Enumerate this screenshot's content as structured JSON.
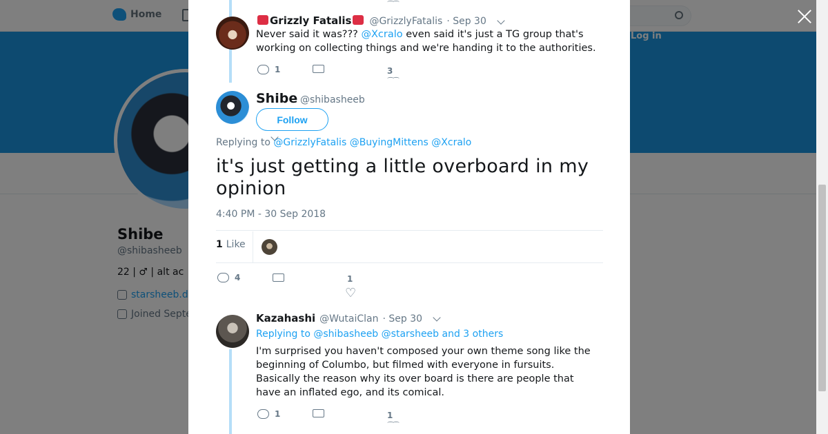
{
  "background_page": {
    "nav": {
      "home_label": "Home",
      "login_label": "Log in"
    },
    "profile": {
      "name": "Shibe",
      "handle": "@shibasheeb",
      "bio_fragment": "22 | ♂ | alt ac",
      "link_fragment": "starsheeb.d",
      "joined_fragment": "Joined Septe"
    }
  },
  "modal": {
    "parent_tweet": {
      "name": "Grizzly Fatalis",
      "handle": "@GrizzlyFatalis",
      "date": "· Sep 30",
      "text_before": "Never said it was??? ",
      "mention": "@Xcralo",
      "text_after": " even said it's just a TG group that's working on collecting things and we're handing it to the authorities.",
      "reply_count": "1",
      "like_count": "3"
    },
    "main_tweet": {
      "name": "Shibe",
      "handle": "@shibasheeb",
      "follow_label": "Follow",
      "replying_label": "Replying to",
      "replying_mentions": [
        "@GrizzlyFatalis",
        "@BuyingMittens",
        "@Xcralo"
      ],
      "text": "it's just getting a little overboard in my opinion",
      "timestamp": "4:40 PM - 30 Sep 2018",
      "likes_count": "1",
      "likes_label": "Like",
      "reply_count": "4",
      "like_count": "1"
    },
    "reply_tweet": {
      "name": "Kazahashi",
      "handle": "@WutaiClan",
      "date": "· Sep 30",
      "replying_label": "Replying to",
      "replying_mentions": [
        "@shibasheeb",
        "@starsheeb"
      ],
      "replying_others": "and 3 others",
      "text": "I'm surprised you haven't composed your own theme song like the beginning of Columbo, but filmed with everyone in fursuits. Basically the reason why its over board is there are people that have an inflated ego, and its comical.",
      "reply_count": "1",
      "like_count": "1"
    }
  },
  "icons": {
    "close": "close-icon",
    "reply": "reply-icon",
    "retweet": "retweet-icon",
    "like": "heart-icon"
  },
  "colors": {
    "accent": "#1da1f2",
    "banner": "#1b95e0",
    "thread_line": "#b5def8",
    "overlay": "rgba(0,0,0,0.5)"
  }
}
